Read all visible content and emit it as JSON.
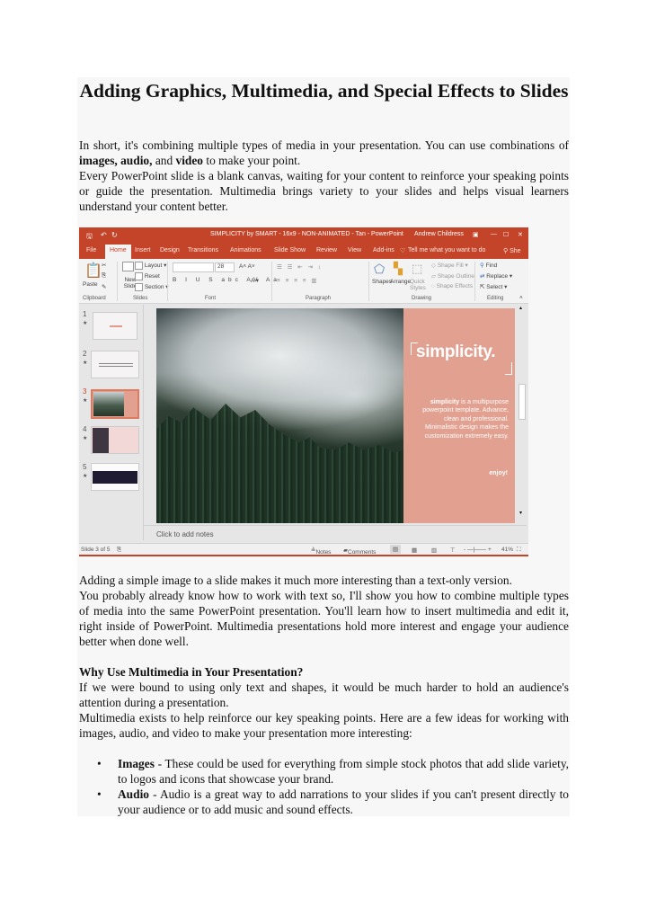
{
  "document": {
    "title": "Adding Graphics, Multimedia, and Special Effects to Slides",
    "intro_p1_a": "In short, it's combining multiple types of media in your presentation. You can use combinations of ",
    "intro_p1_bold": "images, audio,",
    "intro_p1_b": " and ",
    "intro_p1_bold2": "video",
    "intro_p1_c": " to make your point.",
    "intro_p2": "Every PowerPoint slide is a blank canvas, waiting for your content to reinforce your speaking points or guide the presentation. Multimedia brings variety to your slides and helps visual learners understand your content better.",
    "after_p1": "Adding a simple image to a slide makes it much more interesting than a text-only version.",
    "after_p2": "You probably already know how to work with text so, I'll show you how to combine multiple types of media into the same PowerPoint presentation. You'll learn how to insert multimedia and edit it, right inside of PowerPoint. Multimedia presentations hold more interest and engage your audience better when done well.",
    "section_heading": "Why Use Multimedia in Your Presentation?",
    "section_p1": "If we were bound to using only text and shapes, it would be much harder to hold an audience's attention during a presentation.",
    "section_p2": "Multimedia exists to help reinforce our key speaking points. Here are a few ideas for working with images, audio, and video to make your presentation more interesting:",
    "bullets": [
      {
        "term": "Images",
        "text": " - These could be used for everything from simple stock photos that add slide variety, to logos and icons that showcase your brand."
      },
      {
        "term": "Audio",
        "text": " - Audio is a great way to add narrations to your slides if you can't present directly to your audience or to add music and sound effects."
      }
    ]
  },
  "powerpoint": {
    "window_title": "SIMPLICITY by SMART - 16x9 - NON-ANIMATED - Tan  -  PowerPoint",
    "user": "Andrew Childress",
    "tabs": [
      "File",
      "Home",
      "Insert",
      "Design",
      "Transitions",
      "Animations",
      "Slide Show",
      "Review",
      "View",
      "Add-ins"
    ],
    "tell_me": "Tell me what you want to do",
    "share": "Share",
    "ribbon": {
      "paste": "Paste",
      "new_slide": "New Slide",
      "layout": "Layout",
      "reset": "Reset",
      "section": "Section",
      "font_size": "28",
      "shapes": "Shapes",
      "arrange": "Arrange",
      "quick_styles": "Quick Styles",
      "shape_fill": "Shape Fill",
      "shape_outline": "Shape Outline",
      "shape_effects": "Shape Effects",
      "find": "Find",
      "replace": "Replace",
      "select": "Select",
      "groups": [
        "Clipboard",
        "Slides",
        "Font",
        "Paragraph",
        "Drawing",
        "Editing"
      ]
    },
    "thumbnails": [
      "1",
      "2",
      "3",
      "4",
      "5"
    ],
    "selected_slide": 3,
    "slide": {
      "brand": "simplicity.",
      "blurb_bold": "simplicity",
      "blurb": " is a multipurpose powerpoint template. Advance, clean and professional. Minimalistic design makes the customization extremely easy.",
      "enjoy": "enjoy!"
    },
    "notes_placeholder": "Click to add notes",
    "status": {
      "slide_count": "Slide 3 of 5",
      "notes": "Notes",
      "comments": "Comments",
      "zoom": "41%"
    },
    "colors": {
      "accent": "#c4442a",
      "slide_panel": "#e1a090"
    }
  }
}
